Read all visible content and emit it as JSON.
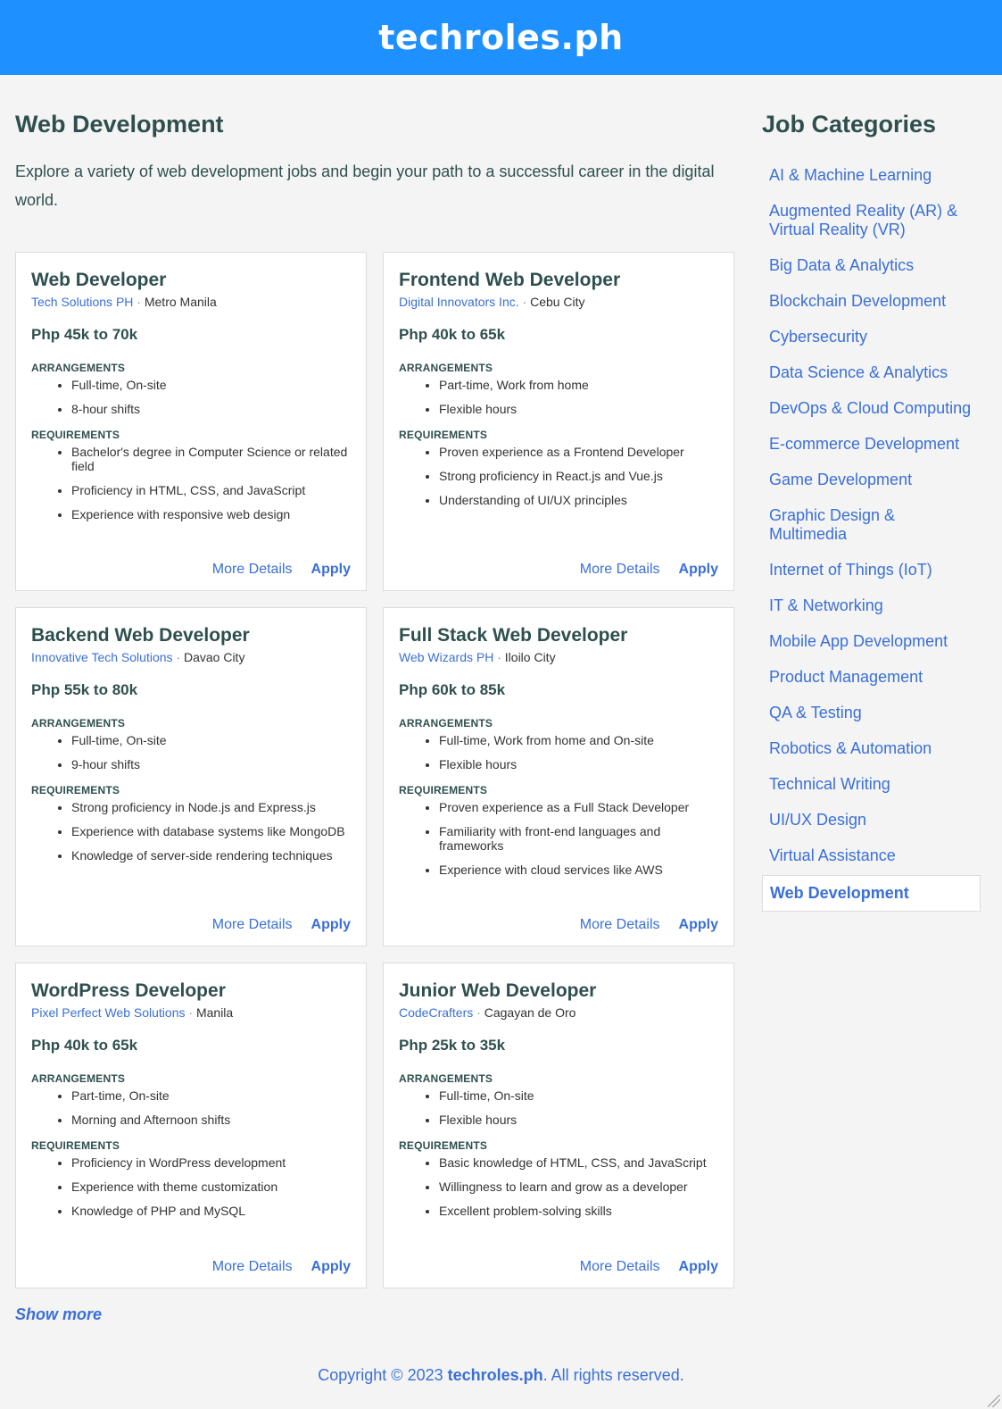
{
  "header": {
    "site_title": "techroles.ph"
  },
  "main": {
    "title": "Web Development",
    "intro": "Explore a variety of web development jobs and begin your path to a successful career in the digital world.",
    "show_more": "Show more",
    "labels": {
      "arrangements": "ARRANGEMENTS",
      "requirements": "REQUIREMENTS",
      "more_details": "More Details",
      "apply": "Apply",
      "separator": "·"
    },
    "jobs": [
      {
        "title": "Web Developer",
        "company": "Tech Solutions PH",
        "location": "Metro Manila",
        "salary_currency": "Php",
        "salary_range": "45k to 70k",
        "arrangements": [
          "Full-time, On-site",
          "8-hour shifts"
        ],
        "requirements": [
          "Bachelor's degree in Computer Science or related field",
          "Proficiency in HTML, CSS, and JavaScript",
          "Experience with responsive web design"
        ]
      },
      {
        "title": "Frontend Web Developer",
        "company": "Digital Innovators Inc.",
        "location": "Cebu City",
        "salary_currency": "Php",
        "salary_range": "40k to 65k",
        "arrangements": [
          "Part-time, Work from home",
          "Flexible hours"
        ],
        "requirements": [
          "Proven experience as a Frontend Developer",
          "Strong proficiency in React.js and Vue.js",
          "Understanding of UI/UX principles"
        ]
      },
      {
        "title": "Backend Web Developer",
        "company": "Innovative Tech Solutions",
        "location": "Davao City",
        "salary_currency": "Php",
        "salary_range": "55k to 80k",
        "arrangements": [
          "Full-time, On-site",
          "9-hour shifts"
        ],
        "requirements": [
          "Strong proficiency in Node.js and Express.js",
          "Experience with database systems like MongoDB",
          "Knowledge of server-side rendering techniques"
        ]
      },
      {
        "title": "Full Stack Web Developer",
        "company": "Web Wizards PH",
        "location": "Iloilo City",
        "salary_currency": "Php",
        "salary_range": "60k to 85k",
        "arrangements": [
          "Full-time, Work from home and On-site",
          "Flexible hours"
        ],
        "requirements": [
          "Proven experience as a Full Stack Developer",
          "Familiarity with front-end languages and frameworks",
          "Experience with cloud services like AWS"
        ]
      },
      {
        "title": "WordPress Developer",
        "company": "Pixel Perfect Web Solutions",
        "location": "Manila",
        "salary_currency": "Php",
        "salary_range": "40k to 65k",
        "arrangements": [
          "Part-time, On-site",
          "Morning and Afternoon shifts"
        ],
        "requirements": [
          "Proficiency in WordPress development",
          "Experience with theme customization",
          "Knowledge of PHP and MySQL"
        ]
      },
      {
        "title": "Junior Web Developer",
        "company": "CodeCrafters",
        "location": "Cagayan de Oro",
        "salary_currency": "Php",
        "salary_range": "25k to 35k",
        "arrangements": [
          "Full-time, On-site",
          "Flexible hours"
        ],
        "requirements": [
          "Basic knowledge of HTML, CSS, and JavaScript",
          "Willingness to learn and grow as a developer",
          "Excellent problem-solving skills"
        ]
      }
    ]
  },
  "sidebar": {
    "title": "Job Categories",
    "active": "Web Development",
    "categories": [
      "AI & Machine Learning",
      "Augmented Reality (AR) & Virtual Reality (VR)",
      "Big Data & Analytics",
      "Blockchain Development",
      "Cybersecurity",
      "Data Science & Analytics",
      "DevOps & Cloud Computing",
      "E-commerce Development",
      "Game Development",
      "Graphic Design & Multimedia",
      "Internet of Things (IoT)",
      "IT & Networking",
      "Mobile App Development",
      "Product Management",
      "QA & Testing",
      "Robotics & Automation",
      "Technical Writing",
      "UI/UX Design",
      "Virtual Assistance",
      "Web Development"
    ]
  },
  "footer": {
    "prefix": "Copyright © 2023 ",
    "brand": "techroles.ph",
    "suffix": ". All rights reserved."
  },
  "colors": {
    "header_bg": "#1e90ff",
    "link": "#3a6fd8",
    "text": "#2f4f4f",
    "page_bg": "#f4f4f4"
  }
}
